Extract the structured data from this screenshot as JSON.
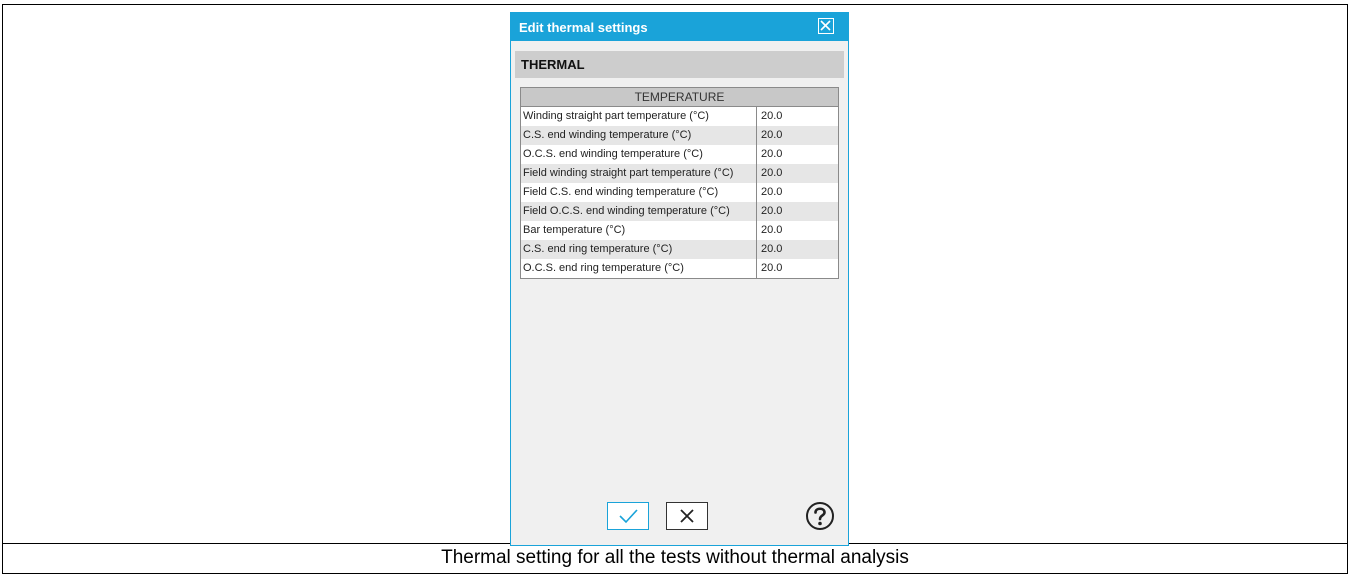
{
  "dialog": {
    "title": "Edit thermal settings",
    "section_label": "THERMAL",
    "table": {
      "header": "TEMPERATURE",
      "rows": [
        {
          "name": "Winding straight part temperature (°C)",
          "value": "20.0"
        },
        {
          "name": "C.S. end winding temperature (°C)",
          "value": "20.0"
        },
        {
          "name": "O.C.S. end winding temperature (°C)",
          "value": "20.0"
        },
        {
          "name": "Field winding straight part temperature (°C)",
          "value": "20.0"
        },
        {
          "name": "Field C.S. end winding temperature (°C)",
          "value": "20.0"
        },
        {
          "name": "Field O.C.S. end winding temperature (°C)",
          "value": "20.0"
        },
        {
          "name": "Bar temperature (°C)",
          "value": "20.0"
        },
        {
          "name": "C.S. end ring temperature (°C)",
          "value": "20.0"
        },
        {
          "name": "O.C.S. end ring temperature (°C)",
          "value": "20.0"
        }
      ]
    },
    "icons": {
      "close": "close-icon",
      "ok": "checkmark-icon",
      "cancel": "x-icon",
      "help": "question-mark-icon"
    },
    "colors": {
      "accent": "#1aa3d9",
      "section_bg": "#cdcdcd",
      "dialog_bg": "#f0f0f0"
    }
  },
  "caption": "Thermal setting for all the tests without thermal analysis"
}
